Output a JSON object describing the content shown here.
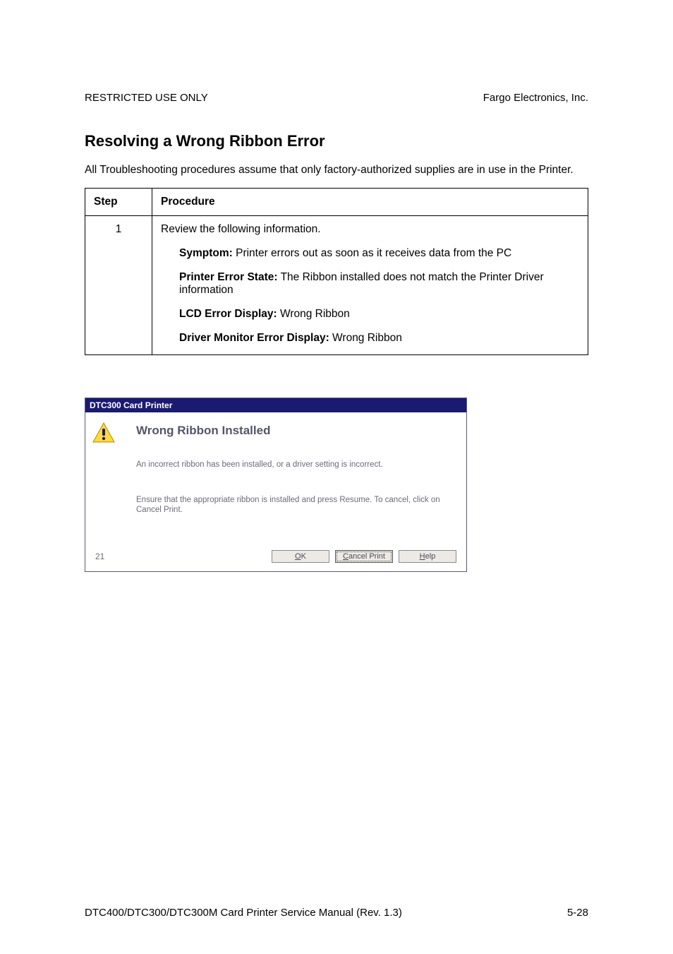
{
  "header": {
    "left": "RESTRICTED USE ONLY",
    "right": "Fargo Electronics, Inc."
  },
  "section_title": "Resolving a Wrong Ribbon Error",
  "intro": "All Troubleshooting procedures assume that only factory-authorized supplies are in use in the Printer.",
  "table": {
    "headers": {
      "step": "Step",
      "procedure": "Procedure"
    },
    "rows": [
      {
        "step": "1",
        "lead": "Review the following information.",
        "symptom_label": "Symptom:",
        "symptom_text": "  Printer errors out as soon as it receives data from the PC",
        "state_label": "Printer Error State:",
        "state_text": "  The Ribbon installed does not match the Printer Driver information",
        "lcd_label": "LCD Error Display:",
        "lcd_text": "  Wrong Ribbon",
        "driver_label": "Driver Monitor Error Display:",
        "driver_text": "  Wrong Ribbon"
      }
    ]
  },
  "dialog": {
    "title": "DTC300 Card Printer",
    "heading": "Wrong Ribbon Installed",
    "line1": "An incorrect ribbon has been installed, or a driver setting is incorrect.",
    "line2": "Ensure that the appropriate ribbon is installed and press Resume. To cancel, click on Cancel Print.",
    "counter": "21",
    "buttons": {
      "ok": "OK",
      "cancel": "Cancel Print",
      "help": "Help"
    }
  },
  "footer": {
    "left": "DTC400/DTC300/DTC300M Card Printer Service Manual (Rev. 1.3)",
    "right": "5-28"
  }
}
